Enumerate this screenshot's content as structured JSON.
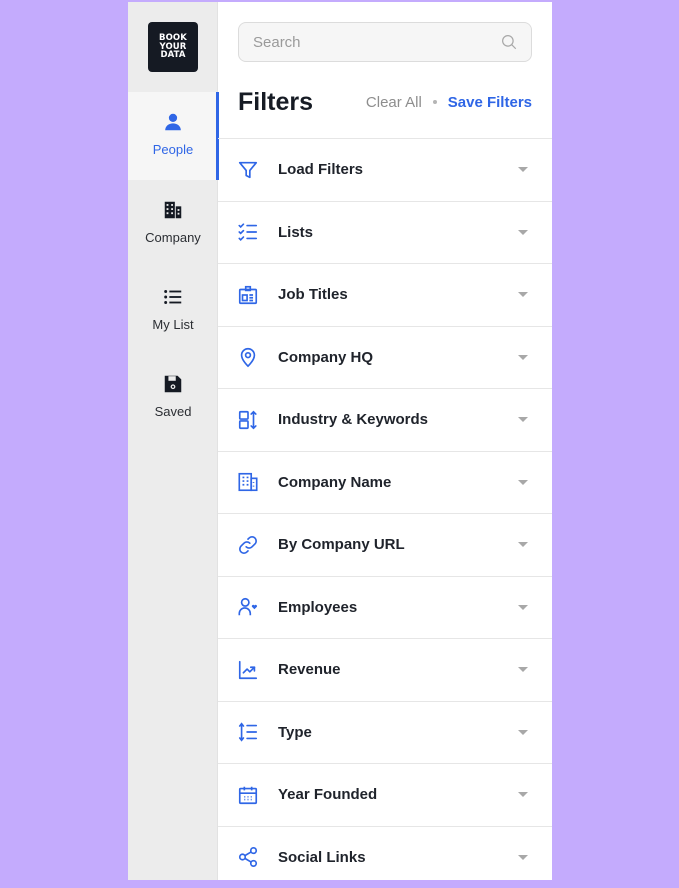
{
  "brand": {
    "logo_lines": [
      "BOOK",
      "YOUR",
      "DATA"
    ]
  },
  "rail": {
    "items": [
      {
        "label": "People",
        "icon": "person-icon",
        "active": true
      },
      {
        "label": "Company",
        "icon": "buildings-icon",
        "active": false
      },
      {
        "label": "My List",
        "icon": "list-icon",
        "active": false
      },
      {
        "label": "Saved",
        "icon": "floppy-disk-icon",
        "active": false
      }
    ]
  },
  "search": {
    "placeholder": "Search",
    "value": "",
    "icon": "search-icon"
  },
  "header": {
    "title": "Filters",
    "clear_label": "Clear All",
    "save_label": "Save Filters"
  },
  "filters": [
    {
      "label": "Load Filters",
      "icon": "funnel-icon"
    },
    {
      "label": "Lists",
      "icon": "checklist-icon"
    },
    {
      "label": "Job Titles",
      "icon": "id-badge-icon"
    },
    {
      "label": "Company HQ",
      "icon": "map-pin-icon"
    },
    {
      "label": "Industry & Keywords",
      "icon": "layout-sort-icon"
    },
    {
      "label": "Company Name",
      "icon": "building-icon"
    },
    {
      "label": "By Company URL",
      "icon": "link-icon"
    },
    {
      "label": "Employees",
      "icon": "user-heart-icon"
    },
    {
      "label": "Revenue",
      "icon": "chart-trend-icon"
    },
    {
      "label": "Type",
      "icon": "sort-list-icon"
    },
    {
      "label": "Year Founded",
      "icon": "calendar-icon"
    },
    {
      "label": "Social Links",
      "icon": "share-icon"
    }
  ],
  "colors": {
    "accent": "#2f66e6",
    "background": "#c4abfd",
    "rail": "#ececec",
    "logo_bg": "#151a23"
  }
}
